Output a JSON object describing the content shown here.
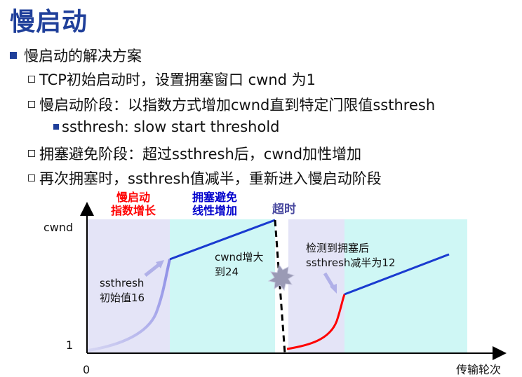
{
  "title": "慢启动",
  "bullets": {
    "main": "慢启动的解决方案",
    "items": [
      "TCP初始启动时，设置拥塞窗口 cwnd 为1",
      "慢启动阶段：以指数方式增加cwnd直到特定门限值ssthresh"
    ],
    "sub": "ssthresh: slow start threshold",
    "items2": [
      "拥塞避免阶段：超过ssthresh后，cwnd加性增加",
      "再次拥塞时，ssthresh值减半，重新进入慢启动阶段"
    ]
  },
  "diagram": {
    "phase_slow_line1": "慢启动",
    "phase_slow_line2": "指数增长",
    "phase_avoid_line1": "拥塞避免",
    "phase_avoid_line2": "线性增加",
    "timeout": "超时",
    "y_axis": "cwnd",
    "y_one": "1",
    "x_origin": "0",
    "x_axis": "传输轮次",
    "note_ssthresh_1": "ssthresh",
    "note_ssthresh_2": "初始值16",
    "note_cwnd_1": "cwnd增大",
    "note_cwnd_2": "到24",
    "note_detect_1": "检测到拥塞后",
    "note_detect_2": "ssthresh减半为12",
    "colors": {
      "slow_bg": "#e4e4f7",
      "avoid_bg": "#cff7f5",
      "slow_label": "#ff0000",
      "avoid_label": "#0000cc",
      "timeout_label": "#4a4aa0",
      "linear_line": "#1a3bd0",
      "restart_curve": "#ff0000"
    }
  }
}
